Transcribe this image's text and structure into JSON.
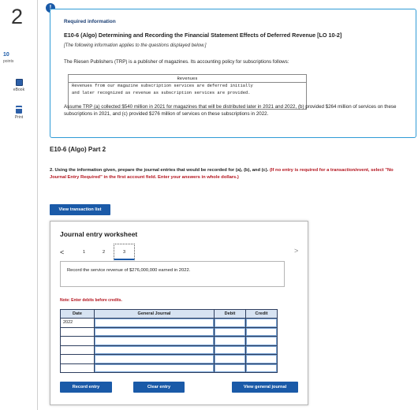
{
  "rail": {
    "question_number": "2",
    "points_value": "10",
    "points_label": "points",
    "ebook_label": "eBook",
    "print_label": "Print"
  },
  "info": {
    "alert_icon": "!",
    "required_label": "Required information",
    "title": "E10-6 (Algo) Determining and Recording the Financial Statement Effects of Deferred Revenue [LO 10-2]",
    "applies_note": "[The following information applies to the questions displayed below.]",
    "intro": "The Riesen Publishers (TRP) is a publisher of magazines. Its accounting policy for subscriptions follows:",
    "policy_header": "Revenues",
    "policy_line1": "Revenues from our magazine subscription services are deferred initially",
    "policy_line2": "and later recognized as revenue as subscription services are provided.",
    "assume": "Assume TRP (a) collected $540 million in 2021 for magazines that will be distributed later in 2021 and 2022, (b) provided $264 million of services on these subscriptions in 2021, and (c) provided $276 million of services on these subscriptions in 2022."
  },
  "part_title": "E10-6 (Algo) Part 2",
  "instructions": {
    "prefix": "2. Using the information given, prepare the journal entries that would be recorded for (a), (b), and (c).",
    "red": "(If no entry is required for a transaction/event, select \"No Journal Entry Required\" in the first account field. Enter your answers in whole dollars.)"
  },
  "buttons": {
    "view_transaction_list": "View transaction list",
    "record_entry": "Record entry",
    "clear_entry": "Clear entry",
    "view_general_journal": "View general journal"
  },
  "worksheet": {
    "title": "Journal entry worksheet",
    "nav_prev": "<",
    "nav_next": ">",
    "pages": [
      "1",
      "2",
      "3"
    ],
    "current_page": "3",
    "prompt": "Record the service revenue of $276,000,000 earned in 2022.",
    "note": "Note: Enter debits before credits.",
    "columns": {
      "date": "Date",
      "journal": "General Journal",
      "debit": "Debit",
      "credit": "Credit"
    },
    "date_value": "2022"
  },
  "colors": {
    "accent_blue": "#1a5aa8",
    "panel_border": "#2f9bd6",
    "header_fill": "#d7e3f2",
    "warning_red": "#b4141e"
  }
}
